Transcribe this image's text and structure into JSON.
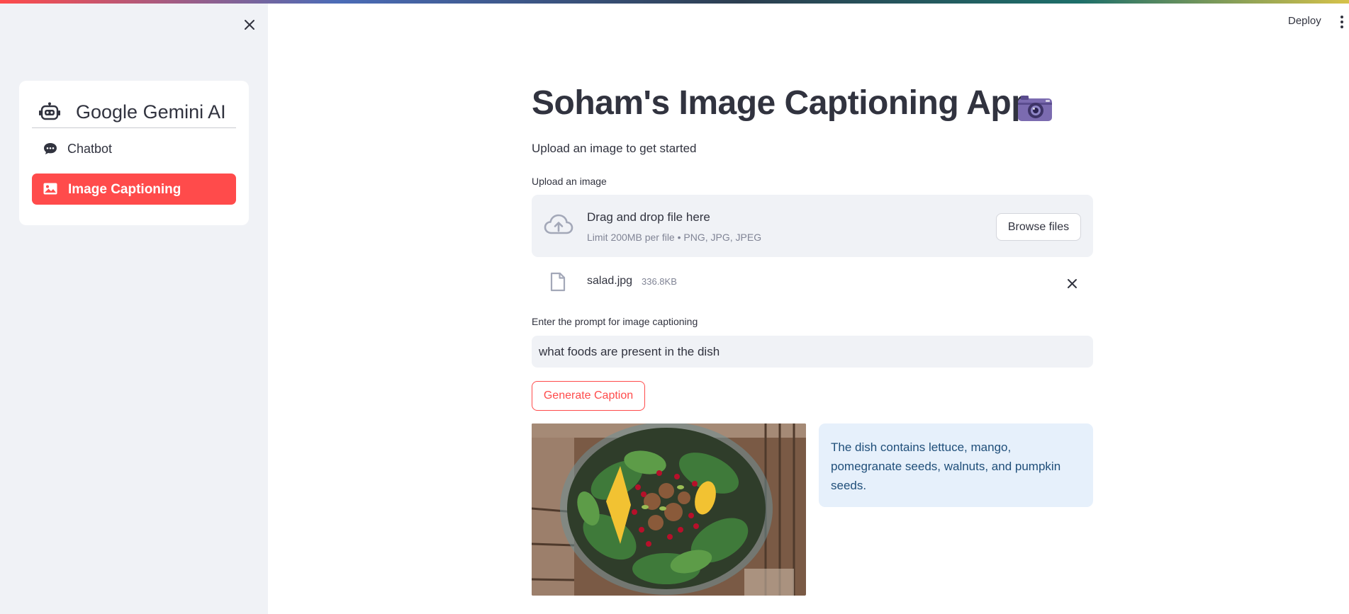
{
  "sidebar": {
    "menu_title": "Google Gemini AI",
    "items": [
      {
        "label": "Chatbot",
        "icon": "chat-bubble-icon",
        "active": false
      },
      {
        "label": "Image Captioning",
        "icon": "image-icon",
        "active": true
      }
    ]
  },
  "header": {
    "deploy_label": "Deploy"
  },
  "main": {
    "title": "Soham's Image Captioning App",
    "subtitle": "Upload an image to get started",
    "uploader": {
      "label": "Upload an image",
      "drop_text": "Drag and drop file here",
      "limit_text": "Limit 200MB per file • PNG, JPG, JPEG",
      "browse_label": "Browse files"
    },
    "uploaded_file": {
      "name": "salad.jpg",
      "size": "336.8KB"
    },
    "prompt": {
      "label": "Enter the prompt for image captioning",
      "value": "what foods are present in the dish"
    },
    "generate_label": "Generate Caption",
    "caption": "The dish contains lettuce, mango, pomegranate seeds, walnuts, and pumpkin seeds."
  },
  "colors": {
    "accent": "#ff4b4b",
    "sidebar_bg": "#f0f2f6",
    "caption_bg": "#e6f0fb",
    "caption_text": "#1f4e79"
  }
}
